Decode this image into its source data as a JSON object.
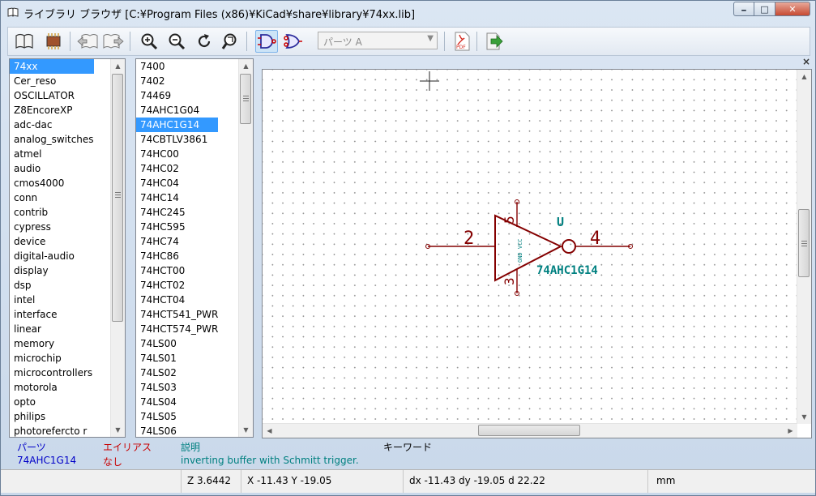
{
  "window": {
    "title": "ライブラリ ブラウザ [C:¥Program Files (x86)¥KiCad¥share¥library¥74xx.lib]",
    "min_label": "━",
    "max_label": "□",
    "close_label": "✕"
  },
  "toolbar": {
    "part_select_placeholder": "パーツ A",
    "icons": [
      "select-library-icon",
      "select-part-icon",
      "previous-part-icon",
      "next-part-icon",
      "zoom-in-icon",
      "zoom-out-icon",
      "refresh-icon",
      "zoom-fit-icon",
      "show-de-morgan-normal-icon",
      "show-de-morgan-alternate-icon",
      "export-pdf-icon",
      "export-to-schematic-icon"
    ]
  },
  "libraries": {
    "selected": "74xx",
    "items": [
      "74xx",
      "Cer_reso",
      "OSCILLATOR",
      "Z8EncoreXP",
      "adc-dac",
      "analog_switches",
      "atmel",
      "audio",
      "cmos4000",
      "conn",
      "contrib",
      "cypress",
      "device",
      "digital-audio",
      "display",
      "dsp",
      "intel",
      "interface",
      "linear",
      "memory",
      "microchip",
      "microcontrollers",
      "motorola",
      "opto",
      "philips",
      "photorefercto r"
    ]
  },
  "parts": {
    "selected": "74AHC1G14",
    "items": [
      "7400",
      "7402",
      "74469",
      "74AHC1G04",
      "74AHC1G14",
      "74CBTLV3861",
      "74HC00",
      "74HC02",
      "74HC04",
      "74HC14",
      "74HC245",
      "74HC595",
      "74HC74",
      "74HC86",
      "74HCT00",
      "74HCT02",
      "74HCT04",
      "74HCT541_PWR",
      "74HCT574_PWR",
      "74LS00",
      "74LS01",
      "74LS02",
      "74LS03",
      "74LS04",
      "74LS05",
      "74LS06"
    ]
  },
  "canvas": {
    "close_label": "×",
    "symbol": {
      "reference": "U",
      "value": "74AHC1G14",
      "input_pin_number": "2",
      "output_pin_number": "4",
      "vcc_pin_number": "5",
      "gnd_pin_number": "3",
      "power_label": "GND VCC"
    }
  },
  "info": {
    "part_header": "パーツ",
    "alias_header": "エイリアス",
    "description_header": "説明",
    "keyword_header": "キーワード",
    "part_value": "74AHC1G14",
    "alias_value": "なし",
    "description_value": "inverting buffer with Schmitt trigger.",
    "keyword_value": "",
    "colors": {
      "part": "#0000c8",
      "alias": "#c80000",
      "description": "#008080"
    }
  },
  "status": {
    "zoom": "Z 3.6442",
    "xy": "X -11.43  Y -19.05",
    "delta": "dx -11.43  dy -19.05  d 22.22",
    "units": "mm"
  }
}
